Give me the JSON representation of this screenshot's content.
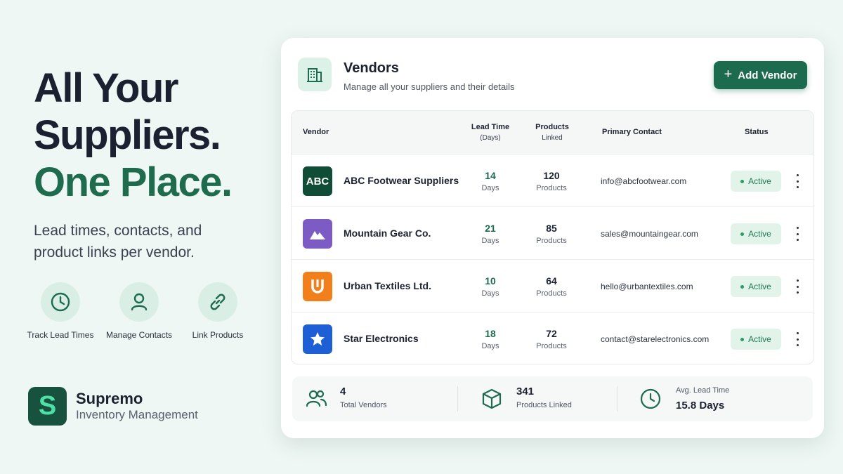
{
  "hero": {
    "line1": "All Your",
    "line2": "Suppliers.",
    "accent": "One Place.",
    "subtitle": "Lead times, contacts, and product links per vendor."
  },
  "features": [
    {
      "label": "Track Lead Times",
      "icon": "clock-icon"
    },
    {
      "label": "Manage Contacts",
      "icon": "user-icon"
    },
    {
      "label": "Link Products",
      "icon": "link-icon"
    }
  ],
  "brand": {
    "logo_letter": "S",
    "name": "Supremo",
    "tagline": "Inventory Management"
  },
  "card": {
    "title": "Vendors",
    "subtitle": "Manage all your suppliers and their details",
    "add_button": "Add Vendor",
    "icon": "building-icon"
  },
  "table": {
    "headers": {
      "vendor": "Vendor",
      "lead_time": "Lead Time",
      "lead_time_unit": "(Days)",
      "products": "Products",
      "products_sub": "Linked",
      "contact": "Primary Contact",
      "status": "Status"
    },
    "rows": [
      {
        "logo_text": "ABC",
        "logo_color": "#0f4d36",
        "name": "ABC Footwear Suppliers",
        "lead_time": "14",
        "lead_unit": "Days",
        "products": "120",
        "products_unit": "Products",
        "email": "info@abcfootwear.com",
        "status": "Active"
      },
      {
        "logo_text": "",
        "logo_color": "#7c5cc4",
        "logo_icon": "mountain-icon",
        "name": "Mountain Gear Co.",
        "lead_time": "21",
        "lead_unit": "Days",
        "products": "85",
        "products_unit": "Products",
        "email": "sales@mountaingear.com",
        "status": "Active"
      },
      {
        "logo_text": "",
        "logo_color": "#f07f1c",
        "logo_icon": "u-magnet-icon",
        "name": "Urban Textiles Ltd.",
        "lead_time": "10",
        "lead_unit": "Days",
        "products": "64",
        "products_unit": "Products",
        "email": "hello@urbantextiles.com",
        "status": "Active"
      },
      {
        "logo_text": "",
        "logo_color": "#1f5fd6",
        "logo_icon": "star-icon",
        "name": "Star Electronics",
        "lead_time": "18",
        "lead_unit": "Days",
        "products": "72",
        "products_unit": "Products",
        "email": "contact@starelectronics.com",
        "status": "Active"
      }
    ]
  },
  "stats": {
    "vendors_value": "4",
    "vendors_label": "Total Vendors",
    "products_value": "341",
    "products_label": "Products Linked",
    "lead_label": "Avg. Lead Time",
    "lead_value": "15.8 Days"
  },
  "colors": {
    "accent": "#1e6b4e",
    "background": "#eef7f3",
    "status_active": "#1f7a52"
  }
}
